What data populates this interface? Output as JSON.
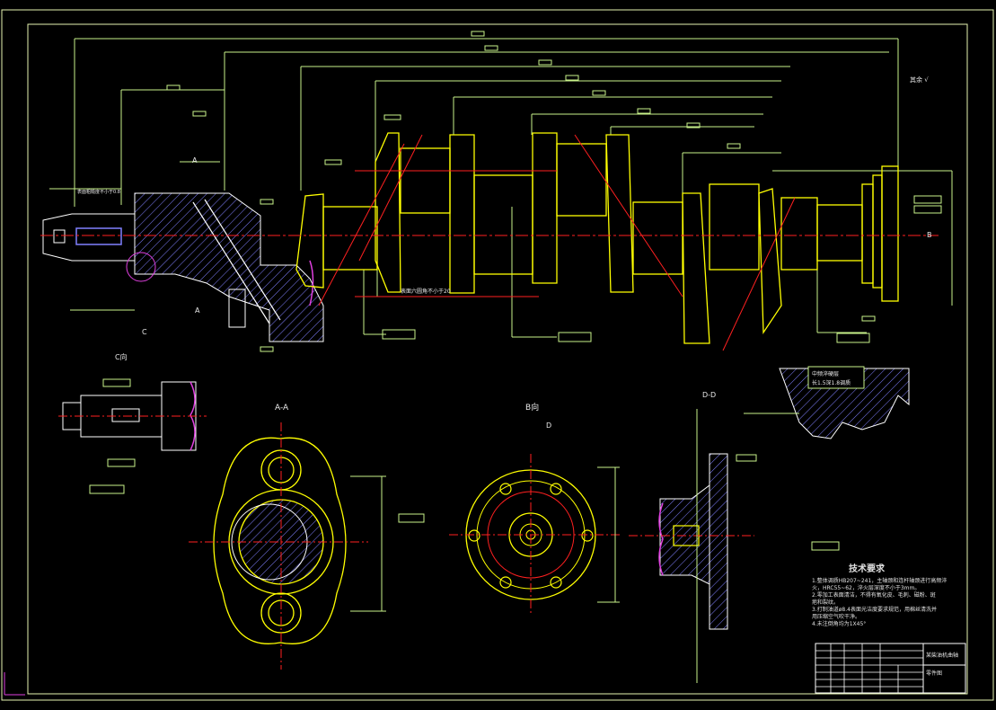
{
  "colors": {
    "background": "#000000",
    "border": "#e6f5b0",
    "dim": "#c8f28a",
    "part": "#ffff00",
    "center": "#ff2020",
    "hatch": "#8080ff",
    "section": "#e040e0",
    "note": "#e8e8e8"
  },
  "drawing": {
    "section_aa_label": "A-A",
    "view_b_label": "B向",
    "section_dd_label": "D-D",
    "view_c_label": "C向",
    "cut_a_top": "A",
    "cut_a_bottom": "A",
    "cut_c": "C",
    "arrow_b": "B",
    "arrow_d": "D",
    "corner_symbol": "其余 √",
    "note_mid": "表面六圆角不小于20",
    "note_left": "表面粗糙度不小于0.8",
    "detail_note_1": "中频淬硬层",
    "detail_note_2": "长1.5深1.8调质"
  },
  "tech_requirements": {
    "title": "技术要求",
    "lines": [
      "1.整体调质HB207~241，主轴颈和连杆轴颈进行高频淬",
      "火，HRC55~62，淬火层深度不小于3mm。",
      "2.零加工表面清洁，不得有氧化皮、毛刺、磁粉、斑",
      "疤和裂纹。",
      "3.打制油道ø8.4表面光洁度要求规范，用棉丝清洗并",
      "用压缩空气吹干净。",
      "4.未注倒角均为1X45°"
    ]
  },
  "title_block": {
    "line1": "某柴油机曲轴",
    "line2": "零件图"
  }
}
